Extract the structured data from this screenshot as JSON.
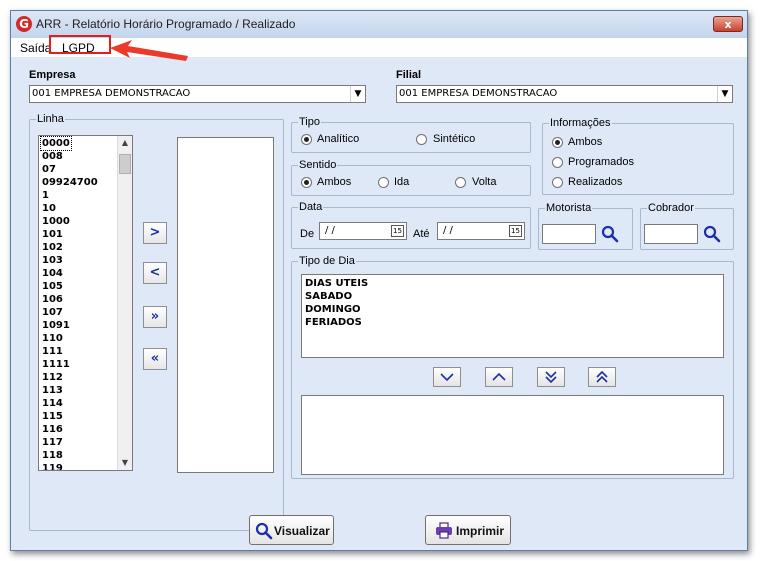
{
  "window": {
    "title": "ARR - Relatório Horário Programado / Realizado",
    "close_label": "x",
    "app_icon": "G"
  },
  "menu": {
    "items": [
      {
        "label": "Saída"
      },
      {
        "label": "LGPD"
      }
    ]
  },
  "empresa": {
    "label": "Empresa",
    "value": "001 EMPRESA DEMONSTRACAO"
  },
  "filial": {
    "label": "Filial",
    "value": "001 EMPRESA DEMONSTRACAO"
  },
  "linha": {
    "label": "Linha",
    "items": [
      "0000",
      "008",
      "07",
      "09924700",
      "1",
      "10",
      "1000",
      "101",
      "102",
      "103",
      "104",
      "105",
      "106",
      "107",
      "1091",
      "110",
      "111",
      "1111",
      "112",
      "113",
      "114",
      "115",
      "116",
      "117",
      "118",
      "119"
    ]
  },
  "nav_buttons": [
    ">",
    "<",
    "»",
    "«"
  ],
  "tipo": {
    "label": "Tipo",
    "options": [
      "Analítico",
      "Sintético"
    ],
    "selected": "Analítico"
  },
  "sentido": {
    "label": "Sentido",
    "options": [
      "Ambos",
      "Ida",
      "Volta"
    ],
    "selected": "Ambos"
  },
  "informacoes": {
    "label": "Informações",
    "options": [
      "Ambos",
      "Programados",
      "Realizados"
    ],
    "selected": "Ambos"
  },
  "data": {
    "label": "Data",
    "de_label": "De",
    "ate_label": "Até",
    "de_value": " / /",
    "ate_value": " / /",
    "cal_label": "15"
  },
  "motorista": {
    "label": "Motorista",
    "value": ""
  },
  "cobrador": {
    "label": "Cobrador",
    "value": ""
  },
  "tipo_dia": {
    "label": "Tipo de Dia",
    "items": [
      "DIAS UTEIS",
      "SABADO",
      "DOMINGO",
      "FERIADOS"
    ]
  },
  "buttons": {
    "visualizar": "Visualizar",
    "imprimir": "Imprimir"
  },
  "colors": {
    "accent_blue": "#1b2fa8",
    "highlight_red": "#e02020",
    "window_bg": "#dfe8f6"
  }
}
